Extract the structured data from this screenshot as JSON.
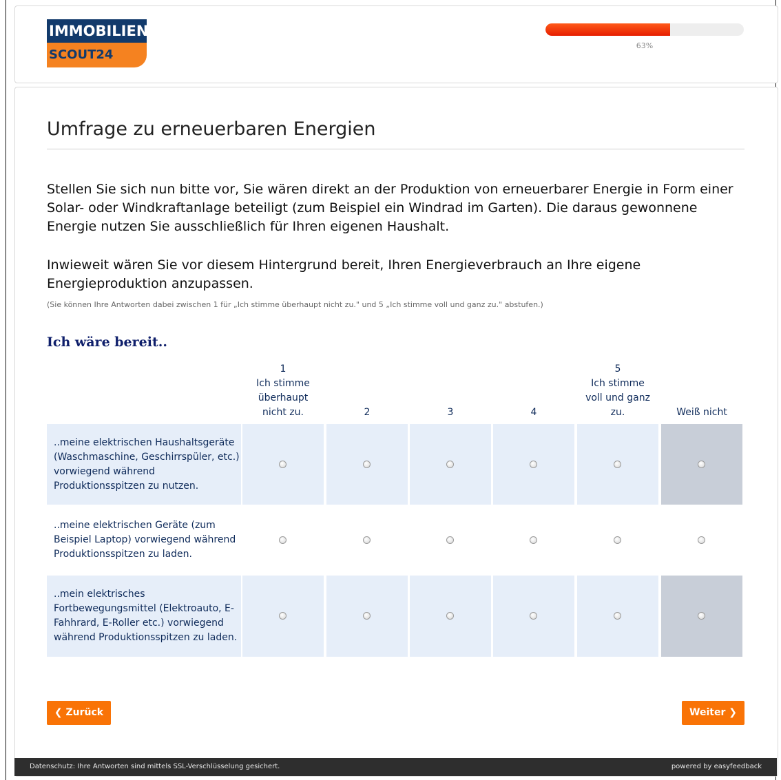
{
  "logo": {
    "line1": "IMMOBILIEN",
    "line2": "SCOUT24"
  },
  "progress": {
    "percent": 63,
    "label": "63%"
  },
  "page_title": "Umfrage zu erneuerbaren Energien",
  "intro": "Stellen Sie sich nun bitte vor, Sie wären direkt an der Produktion von erneuerbarer Energie in Form einer Solar- oder Windkraftanlage beteiligt (zum Beispiel ein Windrad im Garten). Die daraus gewonnene Energie nutzen Sie ausschließlich für Ihren eigenen Haushalt.",
  "question": "Inwieweit wären Sie vor diesem Hintergrund bereit, Ihren Energieverbrauch an Ihre eigene Energieproduktion anzupassen.",
  "hint": "(Sie können Ihre Antworten dabei zwischen 1 für „Ich stimme überhaupt nicht zu.\" und 5 „Ich stimme voll und ganz zu.\" abstufen.)",
  "matrix": {
    "heading": "Ich wäre bereit..",
    "columns": [
      "1\nIch stimme\nüberhaupt\nnicht zu.",
      "2",
      "3",
      "4",
      "5\nIch stimme\nvoll und ganz\nzu.",
      "Weiß nicht"
    ],
    "rows": [
      "..meine elektrischen Haushaltsgeräte (Waschmaschine, Geschirrspüler, etc.) vorwiegend während Produktionsspitzen zu nutzen.",
      "..meine elektrischen Geräte (zum Beispiel Laptop) vorwiegend während Produktionsspitzen zu laden.",
      "..mein elektrisches Fortbewegungsmittel (Elektroauto, E-Fahhrard, E-Roller etc.) vorwiegend während Produktionsspitzen zu laden."
    ]
  },
  "buttons": {
    "back": "❮ Zurück",
    "next": "Weiter ❯"
  },
  "footer": {
    "privacy": "Datenschutz: Ihre Antworten sind mittels SSL-Verschlüsselung gesichert.",
    "powered": "powered by easyfeedback"
  },
  "colors": {
    "accent": "#f97306",
    "progress": "#e61e00",
    "row_tint": "#e6eef9",
    "row_tint_alt": "#c8ced8"
  }
}
